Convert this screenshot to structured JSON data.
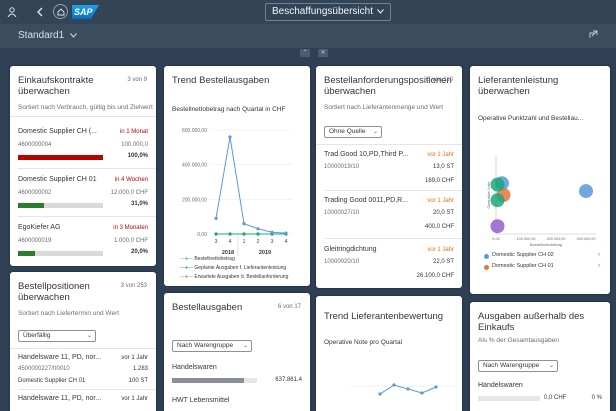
{
  "shell": {
    "app_title": "Beschaffungsübersicht",
    "logo_text": "SAP",
    "variant": "Standard1"
  },
  "cards": {
    "contracts": {
      "title_l1": "Einkaufskontrakte",
      "title_l2": "überwachen",
      "count": "3 von 9",
      "subtitle": "Sortiert nach Verbrauch, gültig bis und Zielwert",
      "items": [
        {
          "name": "Domestic Supplier CH (...",
          "period": "in 1 Monat",
          "id": "4600000004",
          "value": "100.000,0",
          "percent": "100,0%",
          "fill": 1.0,
          "color": "#bb0000"
        },
        {
          "name": "Domestic Supplier CH 01",
          "period": "in 4 Wochen",
          "id": "4600000002",
          "value": "12.000,0 CHF",
          "percent": "31,0%",
          "fill": 0.31,
          "color": "#2b7d2b"
        },
        {
          "name": "EgoKiefer AG",
          "period": "in 3 Monaten",
          "id": "4600000019",
          "value": "1.000,0 CHF",
          "percent": "20,0%",
          "fill": 0.2,
          "color": "#2b7d2b"
        }
      ]
    },
    "trend_spend": {
      "title": "Trend Bestellausgaben",
      "subtitle": "Bestellnettobetrag nach Quartal in CHF",
      "legend": [
        "Bestellnettobetrag",
        "Geplante Ausgaben f. Lieferantenleistung",
        "Erwartete Ausgaben d. Bestellanforderung"
      ]
    },
    "requisitions": {
      "title_l1": "Bestellanforderungspositionen",
      "title_l2": "überwachen",
      "count": "3 von 110",
      "subtitle": "Sortiert nach Lieferantenmenge und Wert",
      "select": "Ohne Quelle",
      "items": [
        {
          "name": "Trad.Good 10,PD,Third P...",
          "period": "vor 1 Jahr",
          "id": "10000019/10",
          "qty": "13,0 ST",
          "value": "169,0 CHF"
        },
        {
          "name": "Trading Good 0011,PD,R...",
          "period": "vor 1 Jahr",
          "id": "10000027/10",
          "qty": "20,0 ST",
          "value": "400,0 CHF"
        },
        {
          "name": "Gleitringdichtung",
          "period": "vor 1 Jahr",
          "id": "10000020/10",
          "qty": "22,0 ST",
          "value": "26.100,0 CHF"
        }
      ]
    },
    "supplier_perf": {
      "title_l1": "Lieferantenleistung",
      "title_l2": "überwachen",
      "subtitle": "Operative Punktzahl und Bestellau...",
      "legend": [
        "Domestic Supplier CH 02",
        "Domestic Supplier CH 01"
      ]
    },
    "po_items": {
      "title_l1": "Bestellpositionen",
      "title_l2": "überwachen",
      "count": "3 von 253",
      "subtitle": "Sortiert nach Liefertermin und Wert",
      "select": "Überfällig",
      "items": [
        {
          "name": "Handelsware 11, PD, nor...",
          "period": "vor 1 Jahr",
          "id": "4500000227/00010",
          "value": "1.283"
        },
        {
          "name": "Domestic Supplier CH 01",
          "period": "",
          "id": "",
          "value": "100 ST"
        },
        {
          "name": "Handelsware 11, PD, nor...",
          "period": "vor 1 Jahr",
          "id": "",
          "value": ""
        }
      ]
    },
    "spend": {
      "title": "Bestellausgaben",
      "count": "6 von 17",
      "select": "Nach Warengruppe",
      "items": [
        {
          "label": "Handelswaren",
          "value": "637.861,4",
          "fill": 0.85
        },
        {
          "label": "HWT Lebensmittel",
          "value": "",
          "fill": 0
        }
      ]
    },
    "trend_rating": {
      "title": "Trend Lieferantenbewertung",
      "subtitle": "Operative Note pro Quartal"
    },
    "outside_spend": {
      "title_l1": "Ausgaben außerhalb des",
      "title_l2": "Einkaufs",
      "subtitle": "Als % der Gesamtausgaben",
      "select": "Nach Warengruppe",
      "items": [
        {
          "label": "Handelswaren",
          "value": "0,0 CHF",
          "percent": "0 %"
        }
      ]
    }
  },
  "chart_data": [
    {
      "type": "line",
      "title": "Trend Bestellausgaben",
      "ylim": [
        0,
        600000
      ],
      "y_ticks": [
        "600.000,00",
        "400.000,00",
        "200.000,00",
        "0,00"
      ],
      "categories": [
        "3",
        "4",
        "1",
        "2",
        "3",
        "4"
      ],
      "group_labels": [
        "2018",
        "2019"
      ],
      "series": [
        {
          "name": "Bestellnettobetrag",
          "values": [
            90000,
            560000,
            60000,
            30000,
            10000,
            5000
          ],
          "color": "#5899da"
        },
        {
          "name": "Geplante Ausgaben f. Lieferantenleistung",
          "values": [
            0,
            0,
            0,
            0,
            0,
            0
          ],
          "color": "#19a979"
        },
        {
          "name": "Erwartete Ausgaben d. Bestellanforderung",
          "values": [
            0,
            0,
            0,
            0,
            0,
            0
          ],
          "color": "#e8743b"
        }
      ]
    },
    {
      "type": "scatter",
      "title": "Lieferantenleistung überwachen",
      "xlabel": "Bestellnettobetrag",
      "ylabel": "Operative Note",
      "x_ticks": [
        "0,00",
        "100.000,00",
        "200.000,00",
        "300.000,00"
      ],
      "y_ticks": [
        "100",
        "80",
        "60",
        "40"
      ],
      "points": [
        {
          "x": 20000,
          "y": 79,
          "color": "#5899da"
        },
        {
          "x": 25000,
          "y": 70,
          "color": "#e8743b"
        },
        {
          "x": 5000,
          "y": 78,
          "color": "#19a979"
        },
        {
          "x": 5000,
          "y": 66,
          "color": "#19a979"
        },
        {
          "x": 5000,
          "y": 46,
          "color": "#945ecf"
        },
        {
          "x": 300000,
          "y": 73,
          "color": "#5899da"
        }
      ]
    }
  ]
}
